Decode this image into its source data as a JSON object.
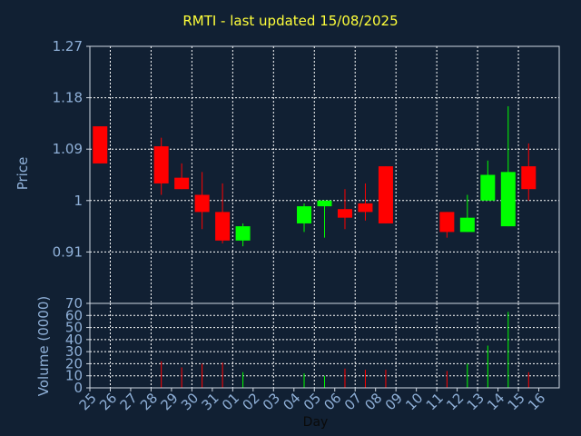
{
  "chart_data": {
    "type": "candlestick",
    "title": "RMTI - last updated 15/08/2025",
    "xlabel": "Day",
    "ylabel_price": "Price",
    "ylabel_volume": "Volume (0000)",
    "x": [
      "25",
      "26",
      "27",
      "28",
      "29",
      "30",
      "31",
      "01",
      "02",
      "03",
      "04",
      "05",
      "06",
      "07",
      "08",
      "09",
      "10",
      "11",
      "12",
      "13",
      "14",
      "15",
      "16"
    ],
    "price_ylim": [
      0.82,
      1.27
    ],
    "price_ticks": [
      "1.27",
      "1.18",
      "1.09",
      "1",
      "0.91"
    ],
    "price_tick_values": [
      1.27,
      1.18,
      1.09,
      1.0,
      0.91
    ],
    "volume_ylim": [
      0,
      70
    ],
    "volume_ticks": [
      "70",
      "60",
      "50",
      "40",
      "30",
      "20",
      "10",
      "0"
    ],
    "volume_tick_values": [
      70,
      60,
      50,
      40,
      30,
      20,
      10,
      0
    ],
    "grid": true,
    "up_color": "#00ff00",
    "down_color": "#ff0000",
    "candles": [
      {
        "day": "25",
        "open": 1.13,
        "high": 1.13,
        "low": 1.065,
        "close": 1.065,
        "volume": 0
      },
      {
        "day": "28",
        "open": 1.095,
        "high": 1.11,
        "low": 1.01,
        "close": 1.03,
        "volume": 22
      },
      {
        "day": "29",
        "open": 1.04,
        "high": 1.065,
        "low": 1.02,
        "close": 1.02,
        "volume": 17
      },
      {
        "day": "30",
        "open": 1.01,
        "high": 1.05,
        "low": 0.95,
        "close": 0.98,
        "volume": 20
      },
      {
        "day": "31",
        "open": 0.98,
        "high": 1.03,
        "low": 0.925,
        "close": 0.93,
        "volume": 21
      },
      {
        "day": "01",
        "open": 0.93,
        "high": 0.96,
        "low": 0.92,
        "close": 0.955,
        "volume": 13
      },
      {
        "day": "04",
        "open": 0.96,
        "high": 0.995,
        "low": 0.945,
        "close": 0.99,
        "volume": 12
      },
      {
        "day": "05",
        "open": 0.99,
        "high": 1.0,
        "low": 0.935,
        "close": 1.0,
        "volume": 10
      },
      {
        "day": "06",
        "open": 0.985,
        "high": 1.02,
        "low": 0.95,
        "close": 0.97,
        "volume": 16
      },
      {
        "day": "07",
        "open": 0.995,
        "high": 1.03,
        "low": 0.965,
        "close": 0.98,
        "volume": 15
      },
      {
        "day": "08",
        "open": 1.06,
        "high": 1.06,
        "low": 0.96,
        "close": 0.96,
        "volume": 15
      },
      {
        "day": "11",
        "open": 0.98,
        "high": 0.98,
        "low": 0.935,
        "close": 0.945,
        "volume": 14
      },
      {
        "day": "12",
        "open": 0.945,
        "high": 1.01,
        "low": 0.945,
        "close": 0.97,
        "volume": 20
      },
      {
        "day": "13",
        "open": 1.0,
        "high": 1.07,
        "low": 1.0,
        "close": 1.045,
        "volume": 35
      },
      {
        "day": "14",
        "open": 0.955,
        "high": 1.165,
        "low": 0.955,
        "close": 1.05,
        "volume": 63
      },
      {
        "day": "15",
        "open": 1.06,
        "high": 1.1,
        "low": 1.0,
        "close": 1.02,
        "volume": 13
      }
    ]
  }
}
